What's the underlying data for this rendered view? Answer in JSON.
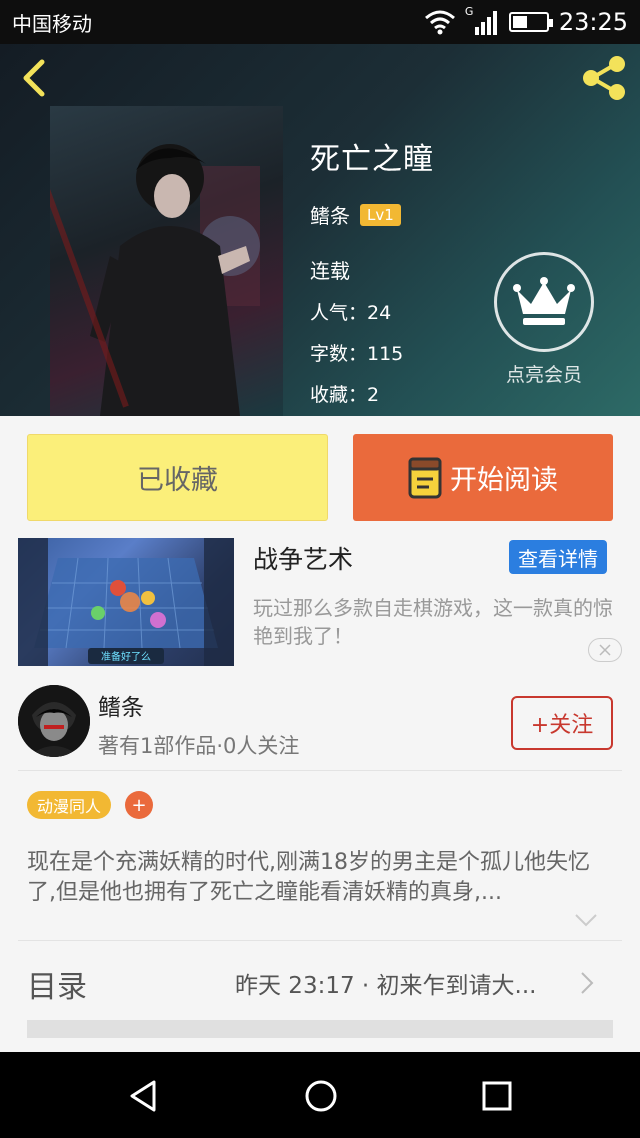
{
  "status_bar": {
    "carrier": "中国移动",
    "network": "G",
    "time": "23:25"
  },
  "book": {
    "title": "死亡之瞳",
    "author": "鳍条",
    "level": "Lv1",
    "status": "连载",
    "popularity": "人气：24",
    "word_count": "字数：115",
    "favorites": "收藏：2",
    "vip_label": "点亮会员"
  },
  "actions": {
    "collected_label": "已收藏",
    "read_label": "开始阅读"
  },
  "ad": {
    "title": "战争艺术",
    "detail_label": "查看详情",
    "description": "玩过那么多款自走棋游戏，这一款真的惊艳到我了！",
    "image_caption": "准备好了么"
  },
  "author_info": {
    "name": "鳍条",
    "meta": "著有1部作品·0人关注",
    "follow_label": "+关注"
  },
  "tags": {
    "items": [
      "动漫同人"
    ],
    "add_label": "+"
  },
  "description": "现在是个充满妖精的时代,刚满18岁的男主是个孤儿他失忆了,但是他也拥有了死亡之瞳能看清妖精的真身,...",
  "catalog": {
    "label": "目录",
    "latest": "昨天 23:17 · 初来乍到请大..."
  },
  "colors": {
    "accent_orange": "#ea6a3c",
    "collected_yellow": "#fbef7a",
    "badge_gold": "#f2b833",
    "follow_red": "#c8382e",
    "detail_blue": "#2b7ee0"
  },
  "icons": [
    "back-arrow-icon",
    "share-icon",
    "crown-icon",
    "book-icon",
    "close-icon",
    "chevron-down-icon",
    "chevron-right-icon",
    "nav-back-icon",
    "nav-home-icon",
    "nav-recent-icon",
    "wifi-icon",
    "signal-icon",
    "battery-icon"
  ]
}
